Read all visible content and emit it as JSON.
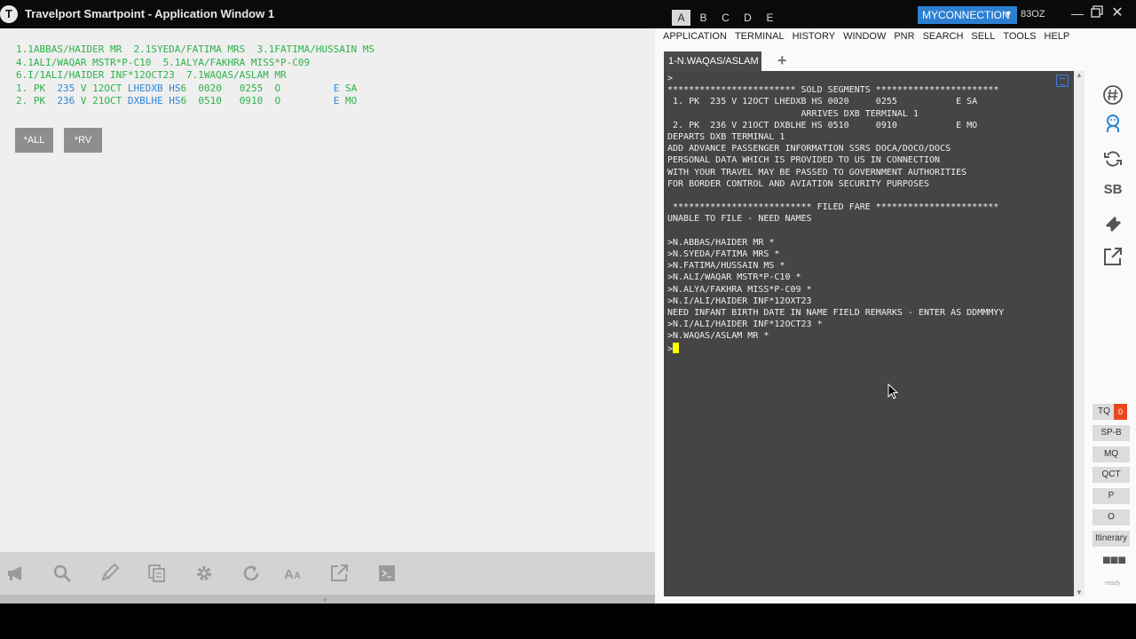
{
  "titlebar": {
    "logo": "T",
    "title": "Travelport Smartpoint - Application Window 1",
    "window_tabs": [
      "A",
      "B",
      "C",
      "D",
      "E"
    ],
    "connection": "MYCONNECTION",
    "pcc": "83OZ"
  },
  "left": {
    "lines": [
      "1.1ABBAS/HAIDER MR  2.1SYEDA/FATIMA MRS  3.1FATIMA/HUSSAIN MS",
      "4.1ALI/WAQAR MSTR*P-C10  5.1ALYA/FAKHRA MISS*P-C09",
      "6.I/1ALI/HAIDER INF*12OCT23  7.1WAQAS/ASLAM MR"
    ],
    "segments": [
      {
        "num": "1. PK  ",
        "flight": "235",
        "cls": " V ",
        "date": "12OCT ",
        "route": "LHEDXB",
        "status": " HS",
        "seats": "6  ",
        "dep": "0020",
        "arr": "0255",
        "o": "O",
        "e": "E",
        "day": "SA"
      },
      {
        "num": "2. PK  ",
        "flight": "236",
        "cls": " V ",
        "date": "21OCT ",
        "route": "DXBLHE",
        "status": " HS",
        "seats": "6  ",
        "dep": "0510",
        "arr": "0910",
        "o": "O",
        "e": "E",
        "day": "MO"
      }
    ],
    "quick_buttons": [
      "*ALL",
      "*RV"
    ],
    "toolbar_icons": [
      "megaphone-icon",
      "search-icon",
      "pencil-icon",
      "copy-icon",
      "gear-icon",
      "refresh-icon",
      "font-size-icon",
      "popout-icon",
      "terminal-icon"
    ]
  },
  "right": {
    "menu": [
      "APPLICATION",
      "TERMINAL",
      "HISTORY",
      "WINDOW",
      "PNR",
      "SEARCH",
      "SELL",
      "TOOLS",
      "HELP"
    ],
    "terminal_tab": "1-N.WAQAS/ASLAM",
    "terminal_text": ">\n************************ SOLD SEGMENTS ***********************\n 1. PK  235 V 12OCT LHEDXB HS 0020     0255           E SA\n                         ARRIVES DXB TERMINAL 1\n 2. PK  236 V 21OCT DXBLHE HS 0510     0910           E MO\nDEPARTS DXB TERMINAL 1\nADD ADVANCE PASSENGER INFORMATION SSRS DOCA/DOCO/DOCS\nPERSONAL DATA WHICH IS PROVIDED TO US IN CONNECTION\nWITH YOUR TRAVEL MAY BE PASSED TO GOVERNMENT AUTHORITIES\nFOR BORDER CONTROL AND AVIATION SECURITY PURPOSES\n\n ************************** FILED FARE ***********************\nUNABLE TO FILE - NEED NAMES\n\n>N.ABBAS/HAIDER MR *\n>N.SYEDA/FATIMA MRS *\n>N.FATIMA/HUSSAIN MS *\n>N.ALI/WAQAR MSTR*P-C10 *\n>N.ALYA/FAKHRA MISS*P-C09 *\n>N.I/ALI/HAIDER INF*12OXT23\nNEED INFANT BIRTH DATE IN NAME FIELD REMARKS - ENTER AS DDMMMYY\n>N.I/ALI/HAIDER INF*12OCT23 *\n>N.WAQAS/ASLAM MR *\n>",
    "side_icons": [
      "hash-icon",
      "agent-icon",
      "sync-icon",
      "sb-icon",
      "ticket-icon",
      "external-link-icon"
    ],
    "sb_label": "SB",
    "tq_label": "TQ",
    "tq_count": "0",
    "side_buttons": [
      "SP-B",
      "MQ",
      "QCT",
      "P",
      "O",
      "Itinerary"
    ],
    "more": "■■■",
    "status": "ready"
  }
}
